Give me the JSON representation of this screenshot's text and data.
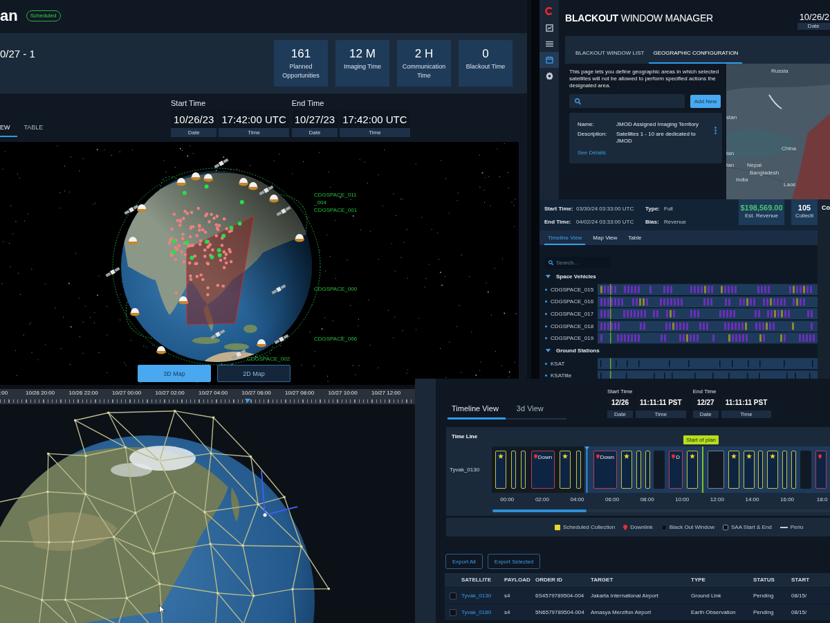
{
  "plan_window": {
    "title": "an",
    "status": "Scheduled",
    "plan_name": "0/27 - 1",
    "stats": [
      {
        "value": "161",
        "label": "Planned Opportunities"
      },
      {
        "value": "12 M",
        "label": "Imaging Time"
      },
      {
        "value": "2 H",
        "label": "Communication Time"
      },
      {
        "value": "0",
        "label": "Blackout Time"
      }
    ],
    "tabs": [
      {
        "label": "EW",
        "selected": true
      },
      {
        "label": "TABLE",
        "selected": false
      }
    ],
    "time_ranges": [
      {
        "heading": "Start Time",
        "date": "10/26/23",
        "date_label": "Date",
        "time": "17:42:00 UTC",
        "time_label": "Time"
      },
      {
        "heading": "End Time",
        "date": "10/27/23",
        "date_label": "Date",
        "time": "17:42:00 UTC",
        "time_label": "Time"
      }
    ],
    "satellite_labels": [
      "CDGSPACE_011",
      "_004",
      "CDGSPACE_001",
      "CDGSPACE_000",
      "CDGSPACE_006",
      "CDGSPACE_002"
    ],
    "map_buttons": [
      {
        "label": "3D Map",
        "selected": true
      },
      {
        "label": "2D Map",
        "selected": false
      }
    ]
  },
  "orbit_window": {
    "time_ticks": [
      ":00",
      "10/26 20:00",
      "10/26 22:00",
      "10/27 00:00",
      "10/27 02:00",
      "10/27 04:00",
      "10/27 06:00",
      "10/27 08:00",
      "10/27 10:00",
      "10/27 12:00"
    ]
  },
  "blackout_window": {
    "title": "**BLACKOUT** WINDOW MANAGER",
    "date": "10/26/2",
    "date_label": "Date",
    "nav": [
      {
        "kind": "report",
        "selected": false
      },
      {
        "kind": "list",
        "selected": false
      },
      {
        "kind": "calendar",
        "selected": true
      },
      {
        "kind": "settings",
        "selected": false
      }
    ],
    "tabs": [
      {
        "label": "BLACKOUT WINDOW LIST",
        "selected": false
      },
      {
        "label": "GEOGRAPHIC CONFIGURATION",
        "selected": true
      }
    ],
    "intro": "This page lets you define geographic areas in which selected satellites will not be allowed to perform specified actions the designated area.",
    "add_button": "Add New",
    "areas": [
      {
        "fields": [
          {
            "label": "Name:",
            "value": "JMOD Assigned Imaging Territory"
          },
          {
            "label": "Description:",
            "value": "Satellites 1 - 10 are dedicated to JMOD"
          }
        ],
        "link": "See Details"
      }
    ],
    "map_labels": [
      "Russia",
      "stan",
      "China",
      "tan",
      "tan",
      "Nepal",
      "Bangladesh",
      "India",
      "Laos"
    ]
  },
  "mission_window": {
    "details": [
      {
        "label": "Start Time:",
        "value": "03/30/24 03:33:00 UTC"
      },
      {
        "label": "Type:",
        "value": "Full"
      },
      {
        "label": "End Time:",
        "value": "04/02/24 03:33:00 UTC"
      },
      {
        "label": "Bias:",
        "value": "Revenue"
      }
    ],
    "stats": [
      {
        "value": "$198,569.00",
        "label": "Est. Revenue",
        "color": "#4cc36f"
      },
      {
        "value": "105",
        "label": "Collecti",
        "color": "#ffffff"
      }
    ],
    "side_panel_title": "Co",
    "tabs": [
      {
        "label": "Timeline View",
        "selected": true
      },
      {
        "label": "Map View",
        "selected": false
      },
      {
        "label": "Table",
        "selected": false
      }
    ],
    "search": {
      "placeholder": "Search..."
    },
    "groups": [
      {
        "label": "Space Vehicles",
        "kind": "vehicle",
        "expanded": true,
        "children": [
          {
            "label": "CDGSPACE_015"
          },
          {
            "label": "CDGSPACE_016"
          },
          {
            "label": "CDGSPACE_017"
          },
          {
            "label": "CDGSPACE_018"
          },
          {
            "label": "CDGSPACE_019"
          }
        ]
      },
      {
        "label": "Ground Stations",
        "kind": "station",
        "expanded": true,
        "children": [
          {
            "label": "KSAT"
          },
          {
            "label": "KSATlite"
          }
        ]
      }
    ]
  },
  "timeline_window": {
    "tabs": [
      {
        "label": "Timeline View",
        "selected": true
      },
      {
        "label": "3d View",
        "selected": false
      }
    ],
    "time_ranges": [
      {
        "heading": "Start Time",
        "date": "12/26",
        "date_label": "Date",
        "time": "11:11:11 PST",
        "time_label": "Time"
      },
      {
        "heading": "End Time",
        "date": "12/27",
        "date_label": "Date",
        "time": "11:11:11 PST",
        "time_label": "Time"
      }
    ],
    "panel_title": "Time Line",
    "row_label": "Tyvak_0130",
    "segments": [
      {
        "elapsed": true,
        "events": [
          {
            "kind": "collection"
          },
          {
            "kind": "slot"
          },
          {
            "kind": "slot"
          },
          {
            "kind": "downlink",
            "label": "Down"
          },
          {
            "kind": "collection"
          },
          {
            "kind": "slot"
          }
        ]
      },
      {
        "elapsed": false,
        "events": [
          {
            "kind": "downlink",
            "label": "Down"
          },
          {
            "kind": "collection"
          },
          {
            "kind": "slot"
          },
          {
            "kind": "slot"
          },
          {
            "kind": "blackout"
          },
          {
            "kind": "downlink",
            "label": "D"
          },
          {
            "kind": "collection"
          },
          {
            "kind": "plan_start",
            "label": "Start of plan"
          },
          {
            "kind": "saa"
          },
          {
            "kind": "collection"
          },
          {
            "kind": "collection"
          },
          {
            "kind": "slot"
          },
          {
            "kind": "collection"
          },
          {
            "kind": "slot"
          },
          {
            "kind": "slot"
          },
          {
            "kind": "blackout"
          },
          {
            "kind": "downlink"
          }
        ]
      }
    ],
    "axis_labels": [
      "00:00",
      "02:00",
      "04:00",
      "06:00",
      "08:00",
      "10:00",
      "12:00",
      "14:00",
      "16:00",
      "18:0"
    ],
    "legend": [
      {
        "kind": "collection",
        "label": "Scheduled Collection"
      },
      {
        "kind": "downlink",
        "label": "Downlink"
      },
      {
        "kind": "blackout",
        "label": "Black Out Window"
      },
      {
        "kind": "saa",
        "label": "SAA Start & End"
      },
      {
        "kind": "period",
        "label": "Perio"
      }
    ],
    "buttons": [
      "Export All",
      "Export Selected"
    ],
    "table": {
      "columns": [
        "SATELLITE",
        "PAYLOAD",
        "ORDER ID",
        "TARGET",
        "TYPE",
        "STATUS",
        "START"
      ],
      "rows": [
        {
          "checked": false,
          "cells": [
            "Tyvak_0130",
            "s4",
            "6S4579789504-004",
            "Jakarta International Airport",
            "Ground Link",
            "Pending",
            "08/15/"
          ]
        },
        {
          "checked": false,
          "cells": [
            "Tyvak_0180",
            "s4",
            "5N6579789504-004",
            "Amasya Merzifon Airport",
            "Earth Observation",
            "Pending",
            "08/15/"
          ]
        }
      ]
    }
  }
}
